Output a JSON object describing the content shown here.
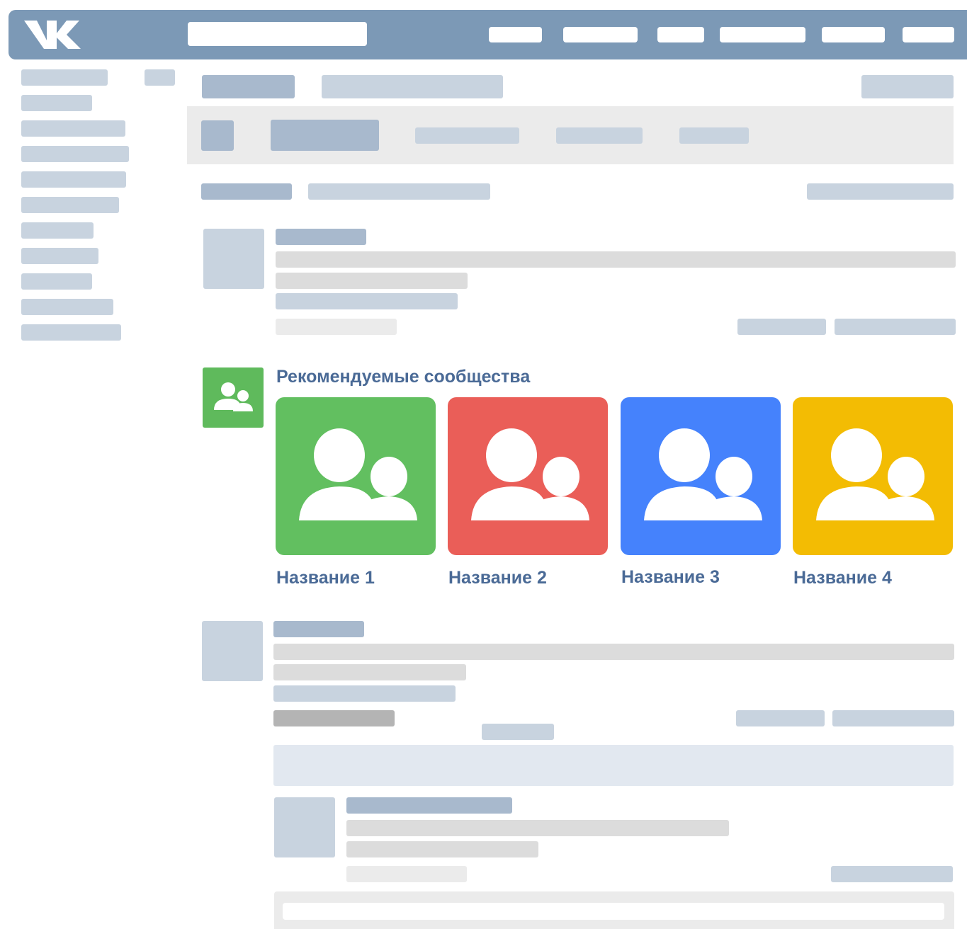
{
  "header": {
    "logo_icon": "vk-logo-icon",
    "nav_buttons": [
      "",
      "",
      "",
      "",
      "",
      ""
    ],
    "search": {
      "value": "",
      "placeholder": ""
    }
  },
  "recommended": {
    "title": "Рекомендуемые сообщества",
    "icon": "communities-icon",
    "colors": {
      "title": "#4a6a96",
      "badge": "#5fba5c"
    },
    "communities": [
      {
        "name": "Название 1",
        "color": "#62bf60",
        "icon": "group-icon"
      },
      {
        "name": "Название 2",
        "color": "#ea5e58",
        "icon": "group-icon"
      },
      {
        "name": "Название 3",
        "color": "#4582fc",
        "icon": "group-icon"
      },
      {
        "name": "Название 4",
        "color": "#f3bc03",
        "icon": "group-icon"
      }
    ]
  },
  "colors": {
    "header": "#7c99b6",
    "link": "#4a6a96"
  }
}
